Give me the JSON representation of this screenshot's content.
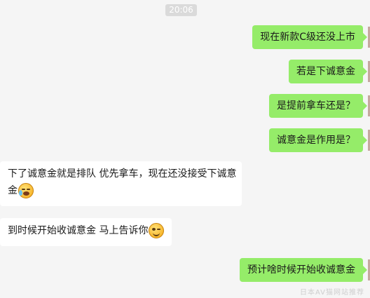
{
  "timestamp": "20:06",
  "messages": [
    {
      "side": "out",
      "text": "现在新款C级还没上市"
    },
    {
      "side": "out",
      "text": "若是下诚意金"
    },
    {
      "side": "out",
      "text": "是提前拿车还是？"
    },
    {
      "side": "out",
      "text": "诚意金是作用是？"
    },
    {
      "side": "in",
      "line1": "下了诚意金就是排队 优先拿车，现在还没接受下诚意",
      "line2": "金",
      "emoji": "crying-laugh-emoji"
    },
    {
      "side": "in",
      "text": "到时候开始收诚意金 马上告诉你",
      "emoji": "wink-smile-emoji"
    },
    {
      "side": "out",
      "text": "预计啥时候开始收诚意金"
    }
  ],
  "watermark": "日本AV猫网站推荐",
  "colors": {
    "background": "#f5f5f5",
    "outgoing_bubble": "#95ec69",
    "incoming_bubble": "#ffffff",
    "timestamp_bg": "#dadada"
  }
}
